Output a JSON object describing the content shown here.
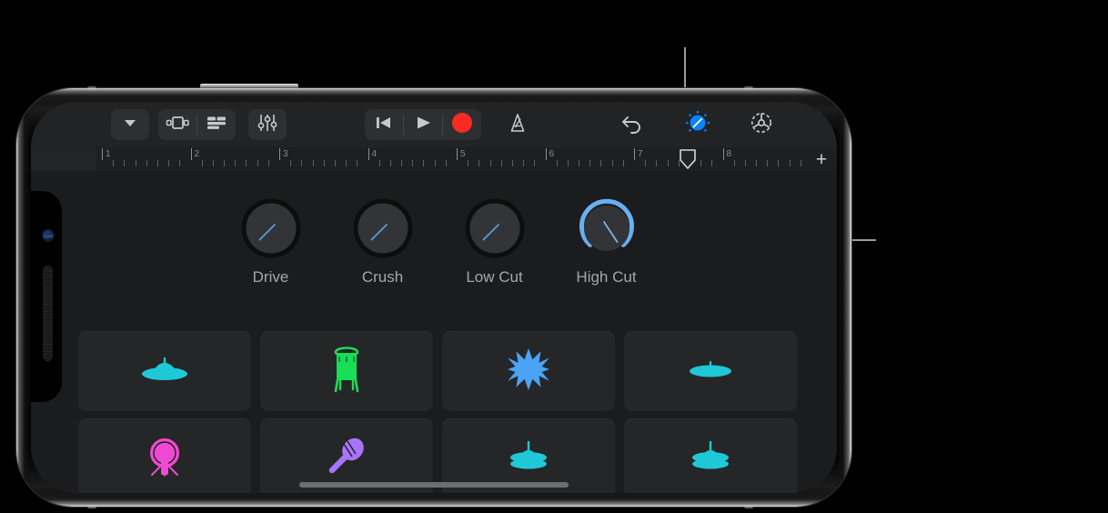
{
  "callouts": {
    "top_pointer_target": "fx-knobs-toggle-icon",
    "right_pointer_target": "high-cut-knob"
  },
  "toolbar": {
    "nav_group": [
      {
        "name": "browser-chevron-down",
        "icon": "chevron-down-icon"
      }
    ],
    "view_group": [
      {
        "name": "track-view",
        "icon": "track-view-icon"
      },
      {
        "name": "track-list",
        "icon": "track-list-icon"
      }
    ],
    "mixer_group": [
      {
        "name": "mixer",
        "icon": "sliders-icon"
      }
    ],
    "transport": [
      {
        "name": "rewind",
        "icon": "rewind-icon"
      },
      {
        "name": "play",
        "icon": "play-icon"
      },
      {
        "name": "record",
        "icon": "record-icon",
        "color": "#fb2b22"
      }
    ],
    "metronome": {
      "name": "metronome",
      "icon": "metronome-icon"
    },
    "undo": {
      "name": "undo",
      "icon": "undo-arrow-icon"
    },
    "fx_knobs": {
      "name": "fx-knobs",
      "icon": "knob-icon",
      "active": true,
      "color": "#0a84ff"
    },
    "settings": {
      "name": "settings",
      "icon": "gear-icon"
    }
  },
  "ruler": {
    "bar_numbers": [
      "1",
      "2",
      "3",
      "4",
      "5",
      "6",
      "7",
      "8"
    ],
    "playhead_bar": 7.6,
    "add_label": "+"
  },
  "fx": {
    "knobs": [
      {
        "label": "Drive",
        "value": 0.0,
        "active": false
      },
      {
        "label": "Crush",
        "value": 0.0,
        "active": false
      },
      {
        "label": "Low Cut",
        "value": 0.0,
        "active": false
      },
      {
        "label": "High Cut",
        "value": 1.0,
        "active": true,
        "ring_color": "#6aaff0"
      }
    ]
  },
  "pads": [
    {
      "name": "pad-crash-cymbal",
      "icon": "crash-cymbal-icon",
      "color": "#1fc8d6"
    },
    {
      "name": "pad-conga",
      "icon": "conga-drum-icon",
      "color": "#2ee05f"
    },
    {
      "name": "pad-clap-burst",
      "icon": "starburst-icon",
      "color": "#4aa3f5"
    },
    {
      "name": "pad-ride-cymbal",
      "icon": "flat-cymbal-icon",
      "color": "#1fc8d6"
    },
    {
      "name": "pad-gong",
      "icon": "gong-icon",
      "color": "#f04ad2"
    },
    {
      "name": "pad-maraca",
      "icon": "maraca-icon",
      "color": "#a874f7"
    },
    {
      "name": "pad-hihat-closed",
      "icon": "hihat-icon",
      "color": "#1fc8d6"
    },
    {
      "name": "pad-hihat-open",
      "icon": "hihat-icon",
      "color": "#1fc8d6"
    }
  ],
  "indicators": {
    "recording_dot_color": "#f0a019"
  }
}
